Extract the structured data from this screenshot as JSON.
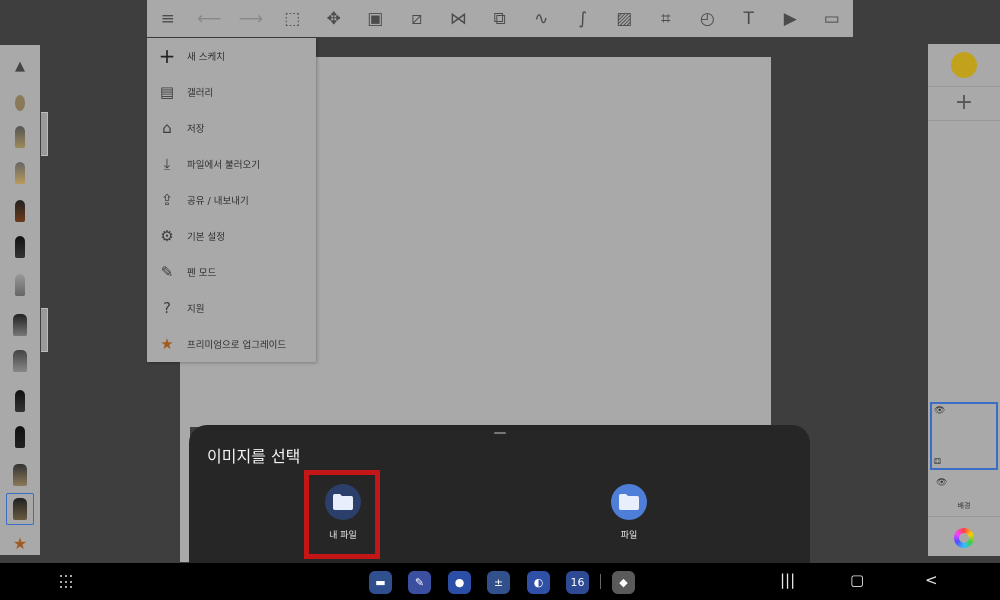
{
  "toolbar": {
    "tools": [
      {
        "name": "list-icon",
        "glyph": "≡",
        "dim": false
      },
      {
        "name": "undo-icon",
        "glyph": "⟵",
        "dim": true
      },
      {
        "name": "redo-icon",
        "glyph": "⟶",
        "dim": true
      },
      {
        "name": "select-icon",
        "glyph": "⬚",
        "dim": false
      },
      {
        "name": "move-icon",
        "glyph": "✥",
        "dim": false
      },
      {
        "name": "layer-transform-icon",
        "glyph": "▣",
        "dim": false
      },
      {
        "name": "ruler-icon",
        "glyph": "⧄",
        "dim": false
      },
      {
        "name": "symmetry-icon",
        "glyph": "⋈",
        "dim": false
      },
      {
        "name": "shape-icon",
        "glyph": "⧉",
        "dim": false
      },
      {
        "name": "curve-icon",
        "glyph": "∿",
        "dim": false
      },
      {
        "name": "stroke-icon",
        "glyph": "∫",
        "dim": false
      },
      {
        "name": "add-image-icon",
        "glyph": "▨",
        "dim": false
      },
      {
        "name": "perspective-icon",
        "glyph": "⌗",
        "dim": false
      },
      {
        "name": "timelapse-icon",
        "glyph": "◴",
        "dim": false
      },
      {
        "name": "text-icon",
        "glyph": "T",
        "dim": false
      },
      {
        "name": "video-icon",
        "glyph": "▶",
        "dim": false
      },
      {
        "name": "fullscreen-icon",
        "glyph": "▭",
        "dim": false
      }
    ]
  },
  "menu": {
    "items": [
      {
        "label": "새 스케치",
        "icon": "plus-icon",
        "glyph": "+"
      },
      {
        "label": "갤러리",
        "icon": "gallery-icon",
        "glyph": "▤"
      },
      {
        "label": "저장",
        "icon": "save-icon",
        "glyph": "⌂"
      },
      {
        "label": "파일에서 불러오기",
        "icon": "import-icon",
        "glyph": "⤓"
      },
      {
        "label": "공유 / 내보내기",
        "icon": "share-icon",
        "glyph": "⇪"
      },
      {
        "label": "기본 설정",
        "icon": "settings-icon",
        "glyph": "⚙"
      },
      {
        "label": "펜 모드",
        "icon": "pen-icon",
        "glyph": "✎"
      },
      {
        "label": "지원",
        "icon": "help-icon",
        "glyph": "?"
      },
      {
        "label": "프리미엄으로 업그레이드",
        "icon": "star-icon",
        "glyph": "★"
      }
    ]
  },
  "layers": {
    "background_label": "배경"
  },
  "sheet": {
    "title": "이미지를 선택",
    "apps": [
      {
        "label": "내 파일",
        "icon": "my-files-icon"
      },
      {
        "label": "파일",
        "icon": "files-icon"
      }
    ]
  },
  "dock": {
    "apps": [
      {
        "name": "my-files-dock-icon",
        "glyph": "▬",
        "color": "#2f4f8f"
      },
      {
        "name": "notes-dock-icon",
        "glyph": "✎",
        "color": "#3a4fa0"
      },
      {
        "name": "contacts-dock-icon",
        "glyph": "●",
        "color": "#2b4fa6"
      },
      {
        "name": "calculator-dock-icon",
        "glyph": "±",
        "color": "#31508c"
      },
      {
        "name": "internet-dock-icon",
        "glyph": "◐",
        "color": "#3050a8"
      },
      {
        "name": "calendar-dock-icon",
        "glyph": "16",
        "color": "#2e4a94"
      },
      {
        "name": "roblox-dock-icon",
        "glyph": "◆",
        "color": "#5a5a5a"
      }
    ]
  },
  "colors": {
    "accent": "#3a6dc4",
    "highlight": "#c41616",
    "brush_color": "#c2a21c",
    "folder_icon_bg": "#4e7ed8"
  }
}
